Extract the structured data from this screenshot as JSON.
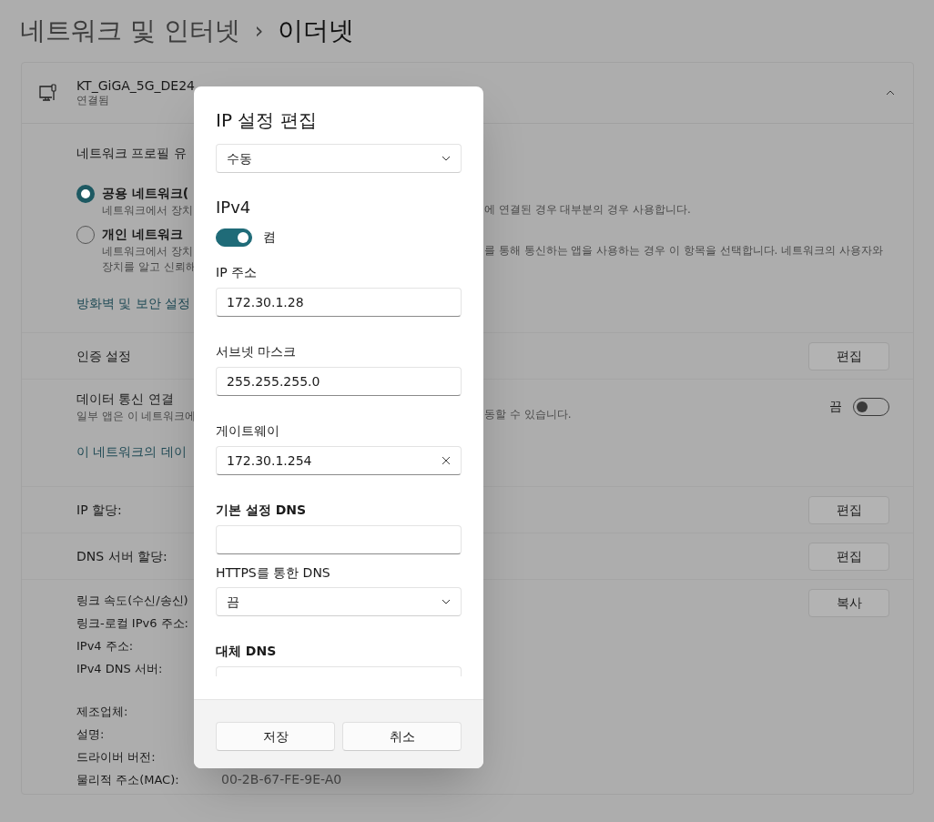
{
  "breadcrumb": {
    "parent": "네트워크 및 인터넷",
    "separator": "›",
    "current": "이더넷"
  },
  "connection": {
    "name": "KT_GiGA_5G_DE24",
    "status": "연결됨",
    "expanded": true
  },
  "profile": {
    "heading": "네트워크 프로필 유",
    "options": [
      {
        "label": "공용 네트워크(",
        "description": [
          {
            "left": "네트워크에서 장치",
            "right": "에 연결된 경우 대부분의 경우 사용합니다."
          }
        ],
        "selected": true
      },
      {
        "label": "개인 네트워크",
        "description": [
          {
            "left": "네트워크에서 장치",
            "right": "를 통해 통신하는 앱을 사용하는 경우 이 항목을 선택합니다. 네트워크의 사용자와"
          },
          {
            "left": "장치를 알고 신뢰해"
          }
        ],
        "selected": false
      }
    ],
    "link": "방화벽 및 보안 설정"
  },
  "rows": [
    {
      "kind": "button",
      "label": "인증 설정",
      "button": "편집"
    },
    {
      "kind": "toggle",
      "label": "데이터 통신 연결",
      "description": {
        "left": "일부 앱은 이 네트워크에",
        "right": "동할 수 있습니다."
      },
      "state_label": "끔",
      "on": false,
      "link": "이 네트워크의 데이"
    },
    {
      "kind": "button",
      "label": "IP 할당:",
      "button": "편집"
    },
    {
      "kind": "button",
      "label": "DNS 서버 할당:",
      "button": "편집"
    }
  ],
  "properties": {
    "button": "복사",
    "groups": [
      [
        {
          "label": "링크 속도(수신/송신)"
        },
        {
          "label": "링크-로컬 IPv6 주소:"
        },
        {
          "label": "IPv4 주소:"
        },
        {
          "label": "IPv4 DNS 서버:"
        }
      ],
      [
        {
          "label": "제조업체:"
        },
        {
          "label": "설명:"
        },
        {
          "label": "드라이버 버전:"
        },
        {
          "label": "물리적 주소(MAC):",
          "value": "00-2B-67-FE-9E-A0"
        }
      ]
    ]
  },
  "dialog": {
    "title": "IP 설정 편집",
    "mode": "수동",
    "section": {
      "heading": "IPv4",
      "toggle": {
        "on": true,
        "label": "켬"
      },
      "fields": [
        {
          "kind": "text",
          "label": "IP 주소",
          "value": "172.30.1.28",
          "label_bold": false,
          "clear_button": false
        },
        {
          "kind": "text",
          "label": "서브넷 마스크",
          "value": "255.255.255.0",
          "label_bold": false,
          "clear_button": false
        },
        {
          "kind": "text",
          "label": "게이트웨이",
          "value": "172.30.1.254",
          "label_bold": false,
          "clear_button": true
        },
        {
          "kind": "text",
          "label": "기본 설정 DNS",
          "label_bold": true,
          "clear_button": false
        },
        {
          "kind": "select",
          "label": "HTTPS를 통한 DNS",
          "value": "끔",
          "label_bold": false
        },
        {
          "kind": "text",
          "label": "대체 DNS",
          "label_bold": true,
          "clear_button": false
        }
      ]
    },
    "buttons": [
      {
        "label": "저장"
      },
      {
        "label": "취소"
      }
    ]
  }
}
